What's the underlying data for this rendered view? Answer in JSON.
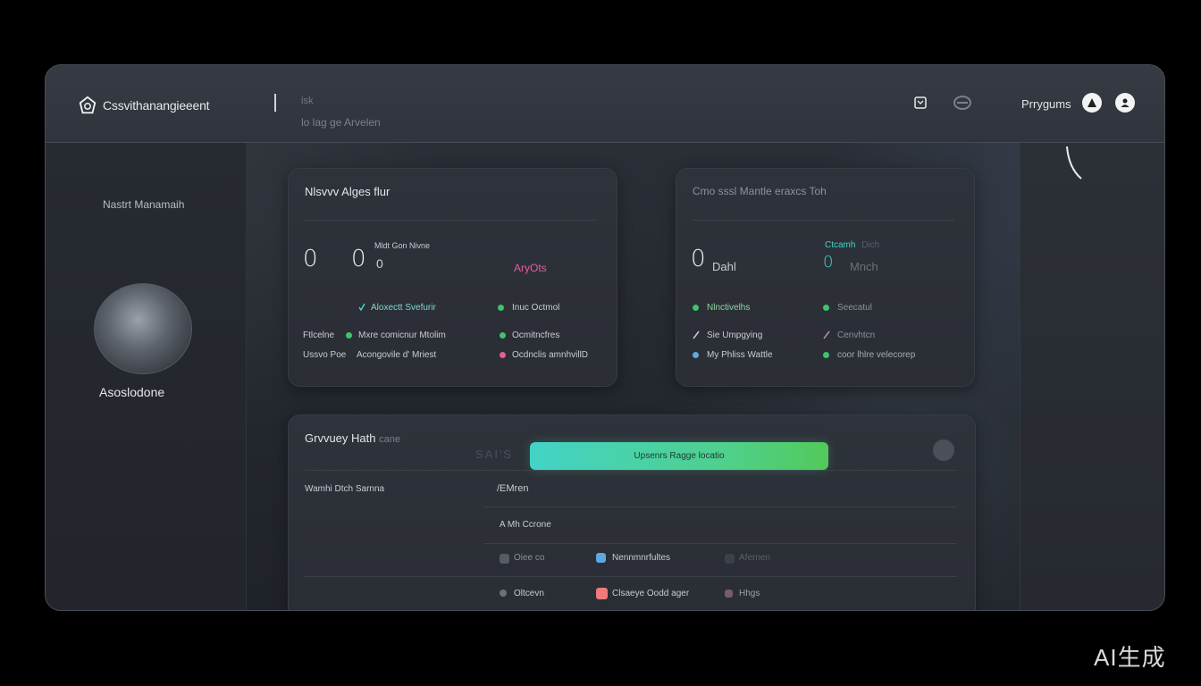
{
  "app": {
    "title": "Cssvithanangieeent"
  },
  "breadcrumb": {
    "line1": "isk",
    "line2": "lo lag ge Arvelen"
  },
  "user": {
    "name": "Prrygums"
  },
  "sidebar": {
    "heading": "Nastrt Manamaih",
    "profile_name": "Asoslodone"
  },
  "card_left": {
    "title": "Nlsvvv Alges flur",
    "num1": "0",
    "num2": "0",
    "num3": "0",
    "sub_label": "Mldt Gon Nivne",
    "accent_label": "AryOts",
    "row1_a": "Aloxectt Svefurir",
    "row1_b": "Inuc Octmol",
    "row2_label": "Ftlcelne",
    "row2_a": "Mxre comicnur Mtolim",
    "row2_b": "Ocmitncfres",
    "row3_label": "Ussvo Poe",
    "row3_a": "Acongovile d' Mriest",
    "row3_b": "Ocdnclis amnhvillD"
  },
  "card_right": {
    "title": "Cmo sssl Mantle eraxcs Toh",
    "num1": "0",
    "num1_label": "Dahl",
    "num2": "0",
    "num2_label": "Mnch",
    "chip_label": "Ctcamh",
    "chip_label2": "Dich",
    "row1_a": "Nlnctivelhs",
    "row1_b": "Seecatul",
    "row2_a": "Sie Umpgying",
    "row2_b": "Cenvhtcn",
    "row3_a": "My Phliss Wattle",
    "row3_b": "coor lhlre velecorep"
  },
  "table": {
    "title": "Grvvuey Hath",
    "title_suffix": "cane",
    "ghost_text": "SAI'S",
    "cta_label": "Upsenrs Ragge locatio",
    "col1_header": "Wamhi Dtch Sarnna",
    "col2_header": "/EMren",
    "row1_c2": "A Mh Ccrone",
    "row2_c2": "Oiee co",
    "row2_c3": "Nennmnrfultes",
    "row2_c4": "Afernen",
    "row3_c2": "Oltcevn",
    "row3_c3": "Clsaeye Oodd ager",
    "row3_c4": "Hhgs"
  },
  "watermark": {
    "text": "AI生成"
  },
  "colors": {
    "green": "#3ec46a",
    "teal": "#43d3c6",
    "pink": "#e35f9a",
    "blue": "#5ea8e0",
    "coral": "#f07a7a",
    "lavender": "#b98ac9"
  }
}
